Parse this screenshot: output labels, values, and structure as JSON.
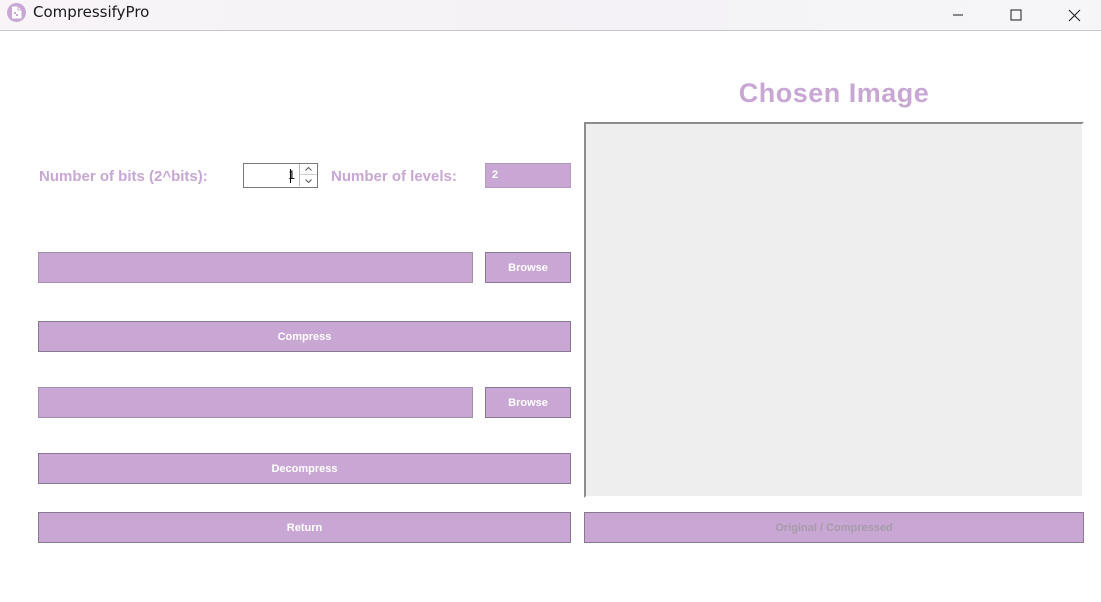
{
  "window": {
    "title": "CompressifyPro",
    "icon": "app-icon",
    "controls": [
      "minimize-icon",
      "maximize-icon",
      "close-icon"
    ]
  },
  "settings": {
    "bits_label": "Number of bits (2^bits):",
    "bits_value": "1",
    "levels_label": "Number of levels:",
    "levels_value": "2"
  },
  "compress": {
    "file_path": "",
    "browse_label": "Browse",
    "action_label": "Compress"
  },
  "decompress": {
    "file_path": "",
    "browse_label": "Browse",
    "action_label": "Decompress"
  },
  "return_label": "Return",
  "preview": {
    "title": "Chosen Image",
    "toggle_label": "Original / Compressed"
  },
  "colors": {
    "accent": "#c9a7d4",
    "panel": "#eeeeee",
    "disabled_text": "#a69ba9"
  }
}
